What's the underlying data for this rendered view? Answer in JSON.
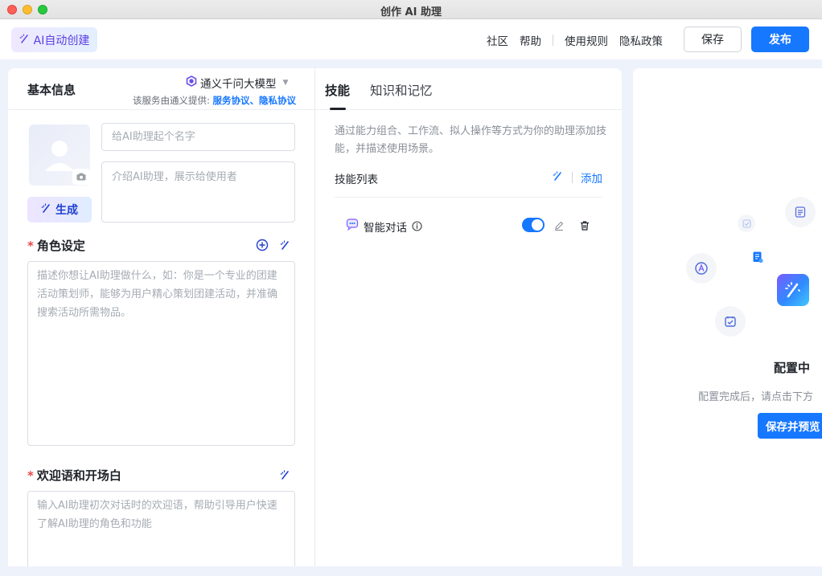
{
  "window": {
    "title": "创作 AI 助理"
  },
  "topbar": {
    "ai_create_label": "AI自动创建",
    "links": [
      "社区",
      "帮助",
      "使用规则",
      "隐私政策"
    ],
    "save_label": "保存",
    "publish_label": "发布"
  },
  "basic": {
    "title": "基本信息",
    "model_name": "通义千问大模型",
    "provider_prefix": "该服务由通义提供: ",
    "service_agreement": "服务协议",
    "separator": "、",
    "privacy_agreement": "隐私协议",
    "name_placeholder": "给AI助理起个名字",
    "intro_placeholder": "介绍AI助理，展示给使用者",
    "generate_label": "生成",
    "role_label": "角色设定",
    "role_placeholder": "描述你想让AI助理做什么，如：你是一个专业的团建活动策划师，能够为用户精心策划团建活动，并准确搜索活动所需物品。",
    "welcome_label": "欢迎语和开场白",
    "welcome_placeholder": "输入AI助理初次对话时的欢迎语，帮助引导用户快速了解AI助理的角色和功能"
  },
  "skills": {
    "tabs": [
      "技能",
      "知识和记忆"
    ],
    "active_tab": "技能",
    "description": "通过能力组合、工作流、拟人操作等方式为你的助理添加技能，并描述使用场景。",
    "list_title": "技能列表",
    "add_label": "添加",
    "items": [
      {
        "name": "智能对话",
        "enabled": true
      }
    ]
  },
  "preview": {
    "title": "配置中",
    "hint": "配置完成后，请点击下方",
    "button_label": "保存并预览"
  },
  "colors": {
    "accent": "#1677ff",
    "required": "#e5484d",
    "magic": "#5b3fe0"
  }
}
